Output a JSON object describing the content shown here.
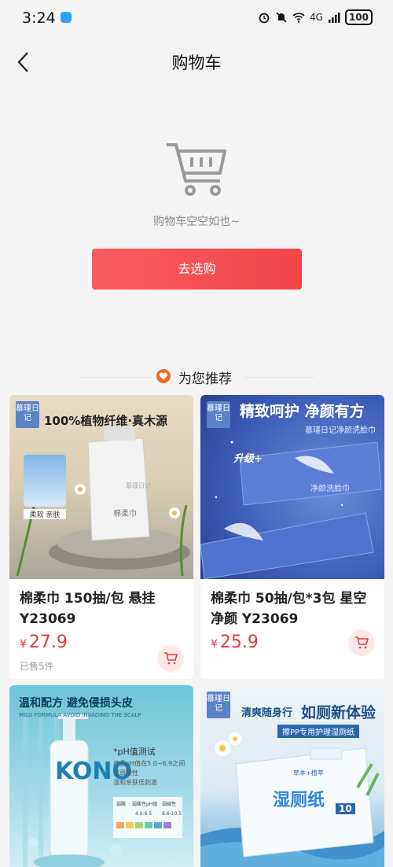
{
  "status_bar": {
    "time": "3:24",
    "signal": "4G",
    "battery": "100"
  },
  "nav": {
    "title": "购物车"
  },
  "empty_cart": {
    "message": "购物车空空如也~",
    "button_label": "去选购"
  },
  "recommend": {
    "title": "为您推荐"
  },
  "products": [
    {
      "name": "棉柔巾 150抽/包 悬挂Y23069",
      "currency": "¥",
      "price": "27.9",
      "sold": "已售5件",
      "logo": "慕瑾日记",
      "headline": "100%植物纤维·真木源",
      "tag": "柔软 亲肤",
      "pack_label": "棉柔巾",
      "pack_note": "慕瑾日记"
    },
    {
      "name": "棉柔巾 50抽/包*3包 星空净颜 Y23069",
      "currency": "¥",
      "price": "25.9",
      "logo": "慕瑾日记",
      "headline": "精致呵护 净颜有方",
      "subline": "慕瑾日记净颜洗脸巾",
      "badge": "升级+",
      "pack_label": "净颜洗脸巾"
    },
    {
      "headline": "温和配方 避免侵损头皮",
      "subline": "MILD FORMULA AVOID INVADING THE SCALP",
      "brand": "KONO",
      "ph_title": "*pH值测试",
      "ph_lines": [
        "产品pH值在5.0~6.9之间",
        "呈弱酸性",
        "温和亲肤低刺激"
      ],
      "ph_table": [
        "弱酸",
        "弱酸性pH值",
        "弱碱性",
        "4.0-6.5",
        "6.6-10.5"
      ]
    },
    {
      "logo": "慕瑾日记",
      "headline_a": "清爽随身行",
      "headline_b": "如厕新体验",
      "subline": "擦PP专用护理湿厕纸",
      "pack_label": "湿厕纸",
      "pack_small": "草本+植萃",
      "pack_count": "10"
    }
  ]
}
